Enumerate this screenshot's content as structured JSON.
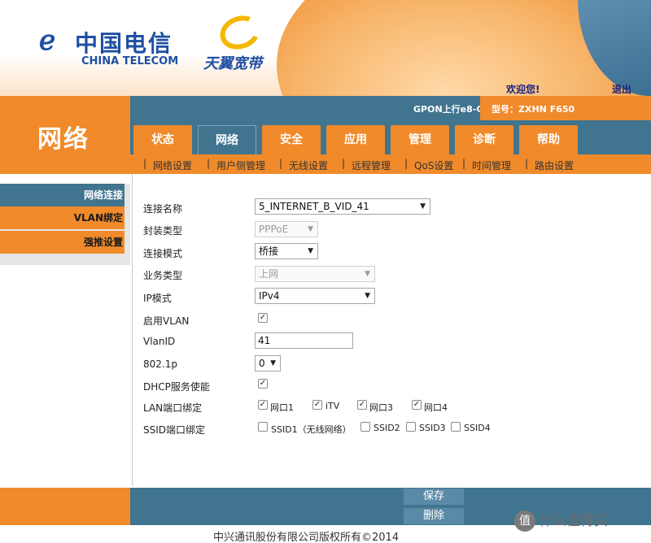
{
  "header": {
    "brand_glyph": "ℯ",
    "brand_cn": "中国电信",
    "brand_en": "CHINA TELECOM",
    "sub_brand": "天翼宽带",
    "welcome": "欢迎您!",
    "logout": "退出"
  },
  "status": {
    "gpon": "GPON上行e8-C",
    "model": "型号：ZXHN F650"
  },
  "section_title": "网络",
  "tabs": [
    {
      "label": "状态",
      "active": false
    },
    {
      "label": "网络",
      "active": true
    },
    {
      "label": "安全",
      "active": false
    },
    {
      "label": "应用",
      "active": false
    },
    {
      "label": "管理",
      "active": false
    },
    {
      "label": "诊断",
      "active": false
    },
    {
      "label": "帮助",
      "active": false
    }
  ],
  "subnav": [
    "网络设置",
    "用户侧管理",
    "无线设置",
    "远程管理",
    "QoS设置",
    "时间管理",
    "路由设置"
  ],
  "left_menu": [
    {
      "label": "网络连接",
      "active": true
    },
    {
      "label": "VLAN绑定",
      "active": false
    },
    {
      "label": "强推设置",
      "active": false
    }
  ],
  "form": {
    "connection_name_label": "连接名称",
    "connection_name_value": "5_INTERNET_B_VID_41",
    "encap_label": "封装类型",
    "encap_value": "PPPoE",
    "mode_label": "连接模式",
    "mode_value": "桥接",
    "service_label": "业务类型",
    "service_value": "上网",
    "ip_mode_label": "IP模式",
    "ip_mode_value": "IPv4",
    "vlan_enable_label": "启用VLAN",
    "vlan_enable_checked": true,
    "vlanid_label": "VlanID",
    "vlanid_value": "41",
    "p8021_label": "802.1p",
    "p8021_value": "0",
    "dhcp_label": "DHCP服务使能",
    "dhcp_checked": true,
    "lan_bind_label": "LAN端口绑定",
    "lan_ports": [
      {
        "label": "网口1",
        "checked": true
      },
      {
        "label": "iTV",
        "checked": true
      },
      {
        "label": "网口3",
        "checked": true
      },
      {
        "label": "网口4",
        "checked": true
      }
    ],
    "ssid_bind_label": "SSID端口绑定",
    "ssid_ports": [
      {
        "label": "SSID1（无线网络）",
        "checked": false
      },
      {
        "label": "SSID2",
        "checked": false
      },
      {
        "label": "SSID3",
        "checked": false
      },
      {
        "label": "SSID4",
        "checked": false
      }
    ]
  },
  "buttons": {
    "save": "保存",
    "delete": "删除"
  },
  "footer": {
    "copyright": "中兴通讯股份有限公司版权所有©2014",
    "watermark_icon": "值",
    "watermark": "什么值得买"
  },
  "colors": {
    "orange": "#f08a2a",
    "blue": "#41748f",
    "brand_blue": "#1f4fa3"
  }
}
